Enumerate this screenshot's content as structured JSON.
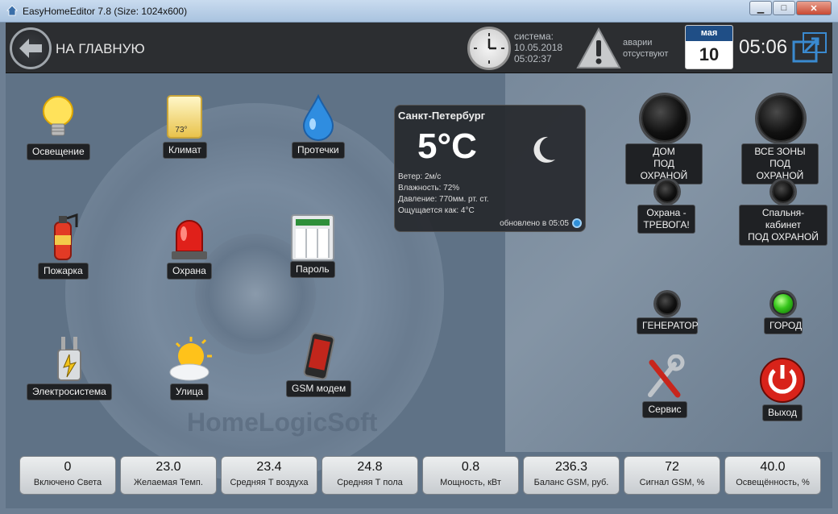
{
  "window": {
    "title": "EasyHomeEditor 7.8 (Size: 1024x600)",
    "buttons": {
      "minimize": "▁",
      "maximize": "□",
      "close": "✕"
    }
  },
  "header": {
    "back_label": "НА ГЛАВНУЮ",
    "system_label": "система:",
    "system_date": "10.05.2018",
    "system_time": "05:02:37",
    "alarm_line1": "аварии",
    "alarm_line2": "отсуствуют",
    "calendar_month": "мая",
    "calendar_day": "10",
    "clock": "05:06"
  },
  "tiles": {
    "lighting": "Освещение",
    "climate": "Климат",
    "climate_temp": "73°",
    "leaks": "Протечки",
    "fire": "Пожарка",
    "security": "Охрана",
    "password": "Пароль",
    "electric": "Электросистема",
    "street": "Улица",
    "gsm": "GSM модем",
    "service": "Сервис",
    "exit": "Выход"
  },
  "weather": {
    "city": "Санкт-Петербург",
    "temp": "5°С",
    "wind": "Ветер: 2м/с",
    "humidity": "Влажность: 72%",
    "pressure": "Давление: 770мм. рт. ст.",
    "feels": "Ощущается как: 4°С",
    "updated": "обновлено в 05:05"
  },
  "lamps": {
    "home_guard": "ДОМ\nПОД ОХРАНОЙ",
    "all_zones": "ВСЕ ЗОНЫ\nПОД ОХРАНОЙ",
    "alarm": "Охрана -\nТРЕВОГА!",
    "bedroom": "Спальня-кабинет\nПОД ОХРАНОЙ",
    "generator": "ГЕНЕРАТОР",
    "city": "ГОРОД",
    "city_status": "on"
  },
  "background": {
    "watermark": "HomeLogicSoft"
  },
  "stats": [
    {
      "value": "0",
      "name": "Включено Света"
    },
    {
      "value": "23.0",
      "name": "Желаемая Темп."
    },
    {
      "value": "23.4",
      "name": "Средняя Т воздуха"
    },
    {
      "value": "24.8",
      "name": "Средняя Т пола"
    },
    {
      "value": "0.8",
      "name": "Мощность, кВт"
    },
    {
      "value": "236.3",
      "name": "Баланс GSM, руб."
    },
    {
      "value": "72",
      "name": "Сигнал GSM, %"
    },
    {
      "value": "40.0",
      "name": "Освещённость, %"
    }
  ]
}
